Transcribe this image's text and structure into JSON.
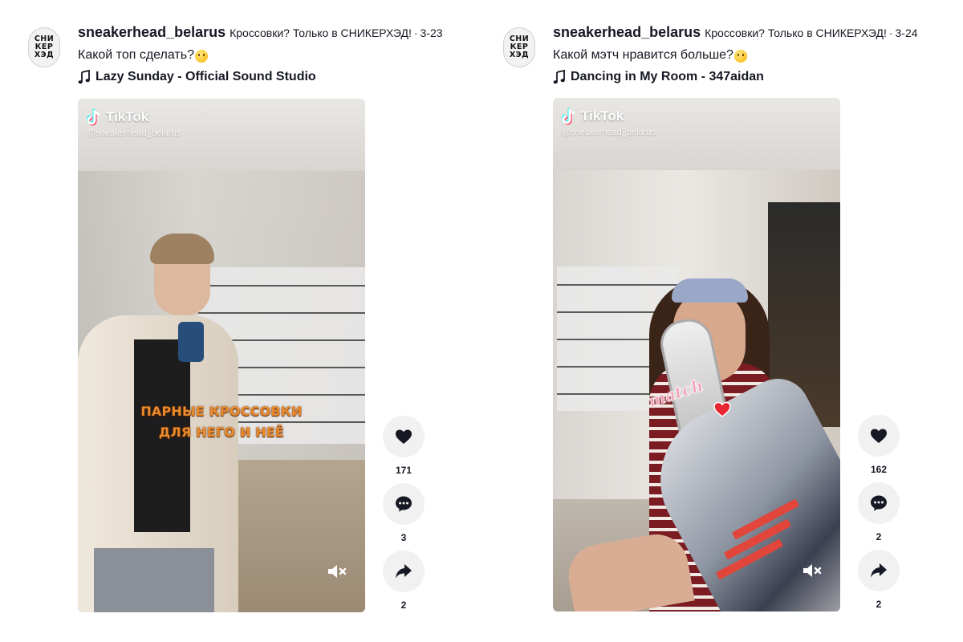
{
  "posts": [
    {
      "avatar_text": [
        "СНИ",
        "КЕР",
        "ХЭД"
      ],
      "username": "sneakerhead_belarus",
      "nickname": "Кроссовки? Только в СНИКЕРХЭД!",
      "separator": "·",
      "date": "3-23",
      "description": "Какой топ сделать?",
      "music": "Lazy Sunday - Official Sound Studio",
      "watermark_brand": "TikTok",
      "watermark_handle": "@sneakerhead_belarus",
      "overlay_lines": [
        "ПАРНЫЕ КРОССОВКИ",
        "ДЛЯ НЕГО И НЕЁ"
      ],
      "likes": "171",
      "comments": "3",
      "shares": "2"
    },
    {
      "avatar_text": [
        "СНИ",
        "КЕР",
        "ХЭД"
      ],
      "username": "sneakerhead_belarus",
      "nickname": "Кроссовки? Только в СНИКЕРХЭД!",
      "separator": "·",
      "date": "3-24",
      "description": "Какой мэтч нравится больше?",
      "music": "Dancing in My Room - 347aidan",
      "watermark_brand": "TikTok",
      "watermark_handle": "@sneakerhead_belarus",
      "sticker_text": "match",
      "likes": "162",
      "comments": "2",
      "shares": "2"
    }
  ],
  "icons": {
    "like": "heart-icon",
    "comment": "comment-icon",
    "share": "share-icon",
    "mute": "volume-mute-icon",
    "music": "music-note-icon"
  },
  "colors": {
    "text": "#161823",
    "action_bg": "#f1f1f2",
    "overlay_text": "#e98a2c",
    "sticker": "#f2a0b7"
  }
}
